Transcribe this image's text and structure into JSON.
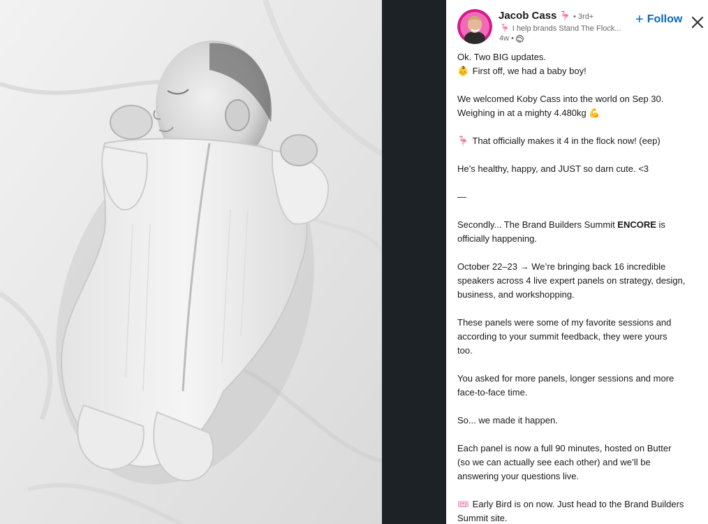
{
  "author": {
    "name": "Jacob Cass",
    "degree": "• 3rd+",
    "headline": "I help brands Stand The Flock...",
    "time": "4w •"
  },
  "follow": {
    "label": "Follow"
  },
  "icons": {
    "name_flamingo": "🦩",
    "headline_flamingo": "🦩",
    "baby": "👶",
    "muscle": "💪",
    "flamingo": "🦩",
    "ticket": "🎟"
  },
  "post": {
    "line1": "Ok. Two BIG updates.",
    "line2": "First off, we had a baby boy!",
    "line3": "We welcomed Koby Cass into the world on Sep 30.",
    "line4": "Weighing in at a mighty 4.480kg",
    "line5": "That officially makes it 4 in the flock now! (eep)",
    "line6": "He’s healthy, happy, and JUST so darn cute. <3",
    "line7": "—",
    "line8a": "Secondly... The Brand Builders Summit ",
    "line8b": "ENCORE",
    "line8c": " is",
    "line9": "officially happening.",
    "line10": "October 22–23 → We’re bringing back 16 incredible",
    "line11": "speakers across 4 live expert panels on strategy, design,",
    "line12": "business, and workshopping.",
    "line13": "These panels were some of my favorite sessions and",
    "line14": "according to your summit feedback, they were yours",
    "line15": "too.",
    "line16": "You asked for more panels, longer sessions and more",
    "line17": "face-to-face time.",
    "line18": "So... we made it happen.",
    "line19": "Each panel is now a full 90 minutes, hosted on Butter",
    "line20": "(so we can actually see each other) and we’ll be",
    "line21": "answering your questions live.",
    "line22": "Early Bird is on now. Just head to the Brand Builders",
    "line23": "Summit site."
  },
  "colors": {
    "accent": "#0a66c2",
    "flamingo": "#e2418e",
    "panel_bg": "#ffffff",
    "viewer_bg": "#1d2226"
  }
}
